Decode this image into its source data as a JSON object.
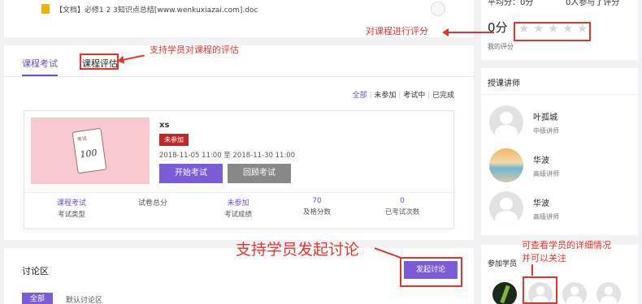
{
  "doc": {
    "icon": "document-icon",
    "text": "【文档】必修1 2 3知识点总结[www.wenkuxiazai.com].doc"
  },
  "tabs": [
    {
      "label": "课程考试"
    },
    {
      "label": "课程评估"
    }
  ],
  "filters": [
    "全部",
    "未参加",
    "考试中",
    "已完成"
  ],
  "exam": {
    "title": "xs",
    "status": "未参加",
    "date_range": "2018-11-05 11:00 至 2018-11-30 11:00",
    "start_button": "开始考试",
    "review_button": "回顾考试",
    "cover_label_top": "考试",
    "cover_score": "100",
    "stats": [
      {
        "value": "课程考试",
        "label": "考试类型"
      },
      {
        "value": "试卷总分",
        "label": ""
      },
      {
        "value": "未参加",
        "label": "考试成绩"
      },
      {
        "value": "70",
        "label": "及格分数"
      },
      {
        "value": "0",
        "label": "已考试次数"
      }
    ]
  },
  "discussion": {
    "title": "讨论区",
    "start_button": "发起讨论",
    "tab_all": "全部",
    "default_area": "默认讨论区"
  },
  "rating": {
    "avg_text": "平均分：0分",
    "count_text": "0人参与了评分",
    "score": "0分",
    "label": "我的评分",
    "stars": 5
  },
  "teachers": {
    "title": "授课讲师",
    "items": [
      {
        "name": "叶孤城",
        "level": "中级讲师"
      },
      {
        "name": "华波",
        "level": "高级讲师"
      },
      {
        "name": "华波",
        "level": "高级讲师"
      }
    ]
  },
  "students": {
    "title": "参加学员"
  },
  "annotations": {
    "rate_course": "对课程进行评分",
    "evaluate": "支持学员对课程的评估",
    "discussion": "支持学员发起讨论",
    "student_line1": "可查看学员的详细情况",
    "student_line2": "并可以关注"
  },
  "colors": {
    "accent": "#7b5cd6",
    "annotation": "#e5342c",
    "status_badge": "#c0282a"
  }
}
